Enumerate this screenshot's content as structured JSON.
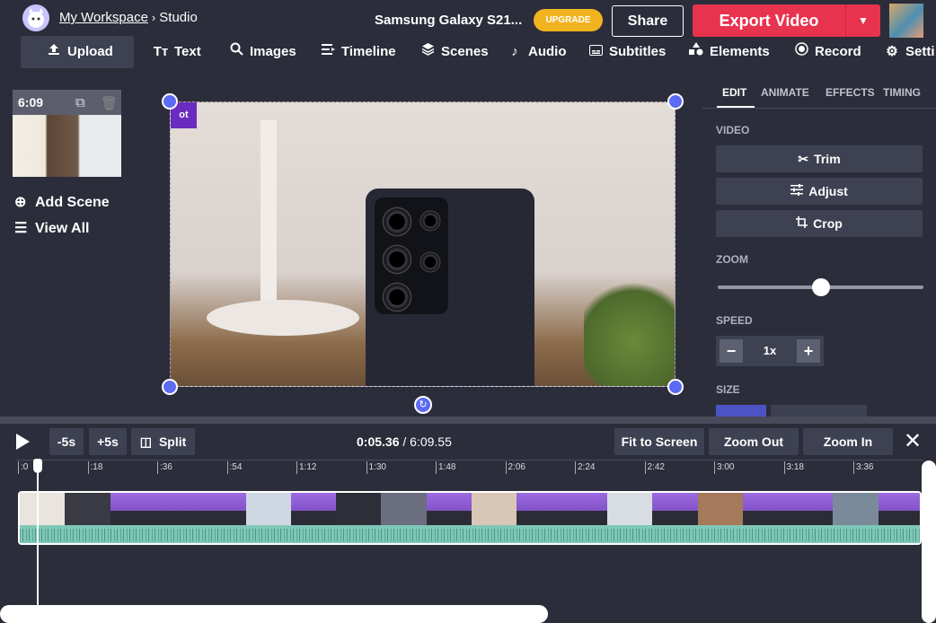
{
  "header": {
    "workspace": "My Workspace",
    "separator": "›",
    "section": "Studio",
    "project_title": "Samsung Galaxy S21...",
    "upgrade_label": "UPGRADE",
    "share_label": "Share",
    "export_label": "Export Video"
  },
  "toolbar": {
    "upload": "Upload",
    "text": "Text",
    "images": "Images",
    "timeline": "Timeline",
    "scenes": "Scenes",
    "audio": "Audio",
    "subtitles": "Subtitles",
    "elements": "Elements",
    "record": "Record",
    "settings": "Setti"
  },
  "scenes": {
    "duration": "6:09",
    "add_scene": "Add Scene",
    "view_all": "View All"
  },
  "canvas": {
    "logo_text": "ot"
  },
  "right_panel": {
    "tabs": [
      "EDIT",
      "ANIMATE",
      "EFFECTS",
      "TIMING"
    ],
    "video_label": "VIDEO",
    "trim": "Trim",
    "adjust": "Adjust",
    "crop": "Crop",
    "zoom_label": "ZOOM",
    "zoom_value": 0.5,
    "speed_label": "SPEED",
    "speed_value": "1x",
    "size_label": "SIZE"
  },
  "timeline": {
    "minus5": "-5s",
    "plus5": "+5s",
    "split": "Split",
    "current_time": "0:05.36",
    "time_sep": " / ",
    "total_time": "6:09.55",
    "fit": "Fit to Screen",
    "zoom_out": "Zoom Out",
    "zoom_in": "Zoom In",
    "ticks": [
      ":0",
      ":18",
      ":36",
      ":54",
      "1:12",
      "1:30",
      "1:48",
      "2:06",
      "2:24",
      "2:42",
      "3:00",
      "3:18",
      "3:36"
    ]
  },
  "colors": {
    "accent": "#5b6bf3",
    "export": "#e8334f",
    "upgrade": "#f2b320",
    "background": "#2b2d3a",
    "waveform": "#7fc8b8"
  }
}
